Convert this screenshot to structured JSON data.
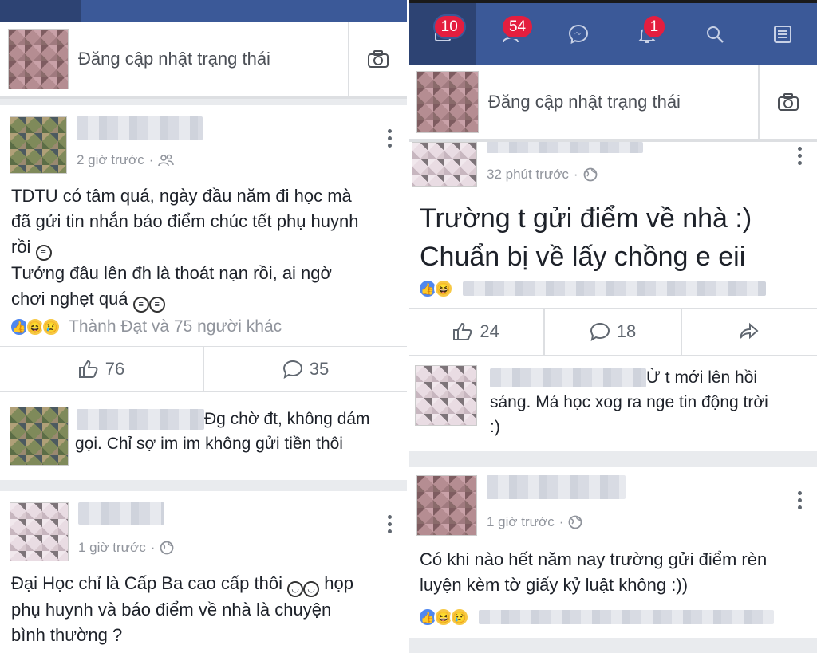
{
  "left": {
    "badge": "",
    "status_placeholder": "Đăng cập nhật trạng thái",
    "post1": {
      "time": "2 giờ trước",
      "text_lines": [
        "TDTU có tâm quá, ngày đầu năm đi học mà",
        "đã gửi tin nhắn báo điểm chúc tết phụ huynh",
        "rồi",
        "Tưởng đâu lên đh là thoát nạn rồi, ai ngờ",
        "chơi nghẹt quá"
      ],
      "reactions_text": "Thành Đạt và 75 người khác",
      "likes": "76",
      "comments": "35",
      "comment_text_1": "Đg chờ đt, không dám",
      "comment_text_2": "gọi. Chỉ sợ im im không gửi tiền thôi"
    },
    "post2": {
      "time": "1 giờ trước",
      "text_line1": "Đại Học chỉ là Cấp Ba cao cấp thôi",
      "text_line1b": "họp",
      "text_line2": "phụ huynh và báo điểm về nhà là chuyện",
      "text_line3": "bình thường ?"
    }
  },
  "right": {
    "nav_badges": [
      "10",
      "54",
      "1"
    ],
    "status_placeholder": "Đăng cập nhật trạng thái",
    "post1": {
      "time": "32 phút trước",
      "text_line1": "Trường t gửi điểm về nhà :)",
      "text_line2": "Chuẩn bị về lấy chồng e eii",
      "likes": "24",
      "comments": "18",
      "comment_text_1": "Ừ t mới lên hồi",
      "comment_text_2": "sáng. Má học xog ra nge tin động trời",
      "comment_text_3": ":)"
    },
    "post2": {
      "time": "1 giờ trước",
      "text_line1": "Có khi nào hết năm nay trường gửi điểm rèn",
      "text_line2": "luyện kèm tờ giấy kỷ luật không :))"
    }
  },
  "colors": {
    "nav_blue": "#3b5998",
    "badge_red": "#e41e3f",
    "like_blue": "#4f87f0"
  }
}
